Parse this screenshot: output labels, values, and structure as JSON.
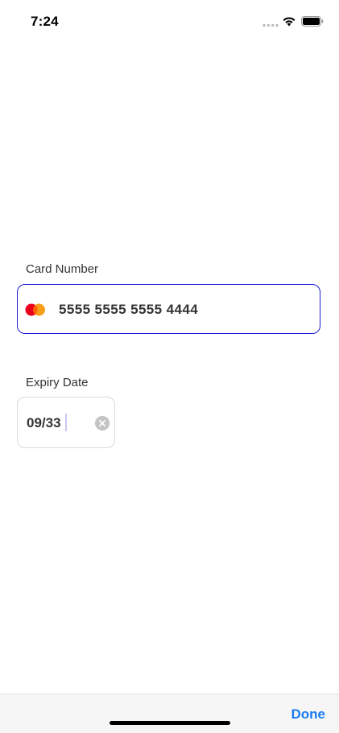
{
  "status_bar": {
    "time": "7:24",
    "icons": [
      "signal-icon",
      "wifi-icon",
      "battery-icon"
    ]
  },
  "form": {
    "card_number": {
      "label": "Card Number",
      "value": "5555 5555 5555 4444",
      "brand_icon": "mastercard-icon"
    },
    "expiry": {
      "label": "Expiry Date",
      "value": "09/33",
      "clear_icon": "clear-icon"
    }
  },
  "accessory_bar": {
    "done_label": "Done"
  },
  "colors": {
    "focus_border": "#1b1bd6",
    "done_blue": "#1a7cf0",
    "mastercard_red": "#eb001b",
    "mastercard_orange": "#f79e1b"
  }
}
